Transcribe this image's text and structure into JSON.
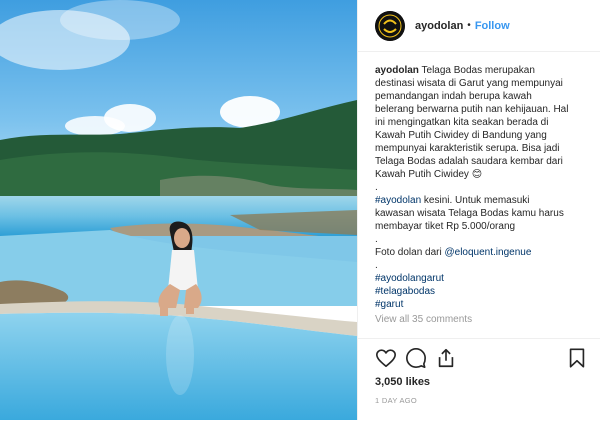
{
  "header": {
    "username": "ayodolan",
    "separator": "•",
    "follow_label": "Follow",
    "avatar_text": "Ayo Dolan"
  },
  "caption": {
    "username": "ayodolan",
    "lines": [
      "Telaga Bodas merupakan",
      "destinasi wisata di Garut yang mempunyai",
      "pemandangan indah berupa kawah",
      "belerang berwarna putih nan kehijauan. Hal",
      "ini mengingatkan kita seakan berada di",
      "Kawah Putih Ciwidey di Bandung yang",
      "mempunyai karakteristik serupa. Bisa jadi",
      "Telaga Bodas adalah saudara kembar dari",
      "Kawah Putih Ciwidey 😊"
    ],
    "dot": ".",
    "hashtag_main": "#ayodolan",
    "promo_lines": [
      " kesini. Untuk memasuki",
      "kawasan wisata Telaga Bodas kamu harus",
      "membayar tiket Rp 5.000/orang"
    ],
    "credit_prefix": "Foto dolan dari ",
    "credit_handle": "@eloquent.ingenue",
    "hashtags": [
      "#ayodolangarut",
      "#telagabodas",
      "#garut"
    ],
    "view_comments": "View all 35 comments"
  },
  "actions": {
    "like_icon": "heart-icon",
    "comment_icon": "comment-icon",
    "share_icon": "share-icon",
    "save_icon": "bookmark-icon"
  },
  "likes": "3,050 likes",
  "timestamp": "1 DAY AGO",
  "colors": {
    "link": "#003569",
    "follow": "#3897f0",
    "muted": "#999999",
    "text": "#262626"
  }
}
